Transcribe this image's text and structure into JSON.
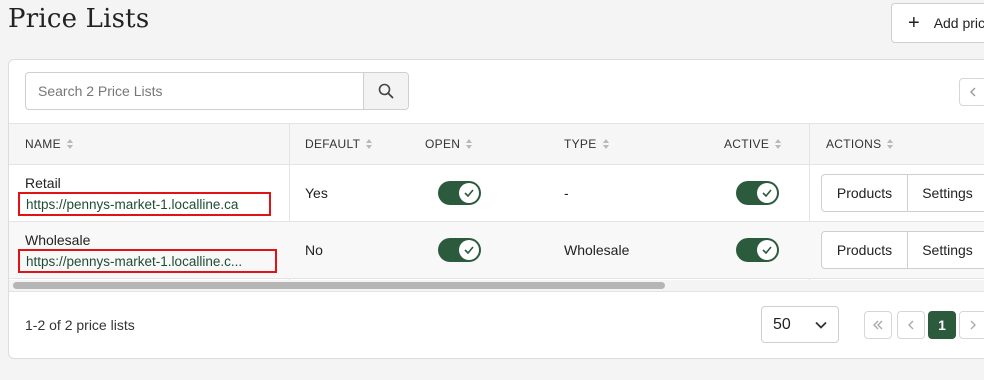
{
  "header": {
    "title": "Price Lists",
    "add_button_label": "Add price list"
  },
  "search": {
    "placeholder": "Search 2 Price Lists",
    "value": ""
  },
  "table": {
    "columns": [
      "NAME",
      "DEFAULT",
      "OPEN",
      "TYPE",
      "ACTIVE",
      "ACTIONS"
    ],
    "rows": [
      {
        "name": "Retail",
        "url": "https://pennys-market-1.localline.ca",
        "default": "Yes",
        "open": true,
        "type": "-",
        "active": true,
        "actions": [
          "Products",
          "Settings"
        ]
      },
      {
        "name": "Wholesale",
        "url": "https://pennys-market-1.localline.c...",
        "default": "No",
        "open": true,
        "type": "Wholesale",
        "active": true,
        "actions": [
          "Products",
          "Settings"
        ]
      }
    ]
  },
  "footer": {
    "summary": "1-2 of 2 price lists",
    "per_page": "50",
    "current_page": "1"
  },
  "colors": {
    "accent_green": "#2c5a3d",
    "highlight_red": "#e01414"
  },
  "icons": {
    "search": "search-icon",
    "add": "plus-icon",
    "toggle_check": "check-icon",
    "pager_first": "double-chevron-left-icon",
    "pager_prev": "chevron-left-icon",
    "pager_next": "chevron-right-icon",
    "dropdown": "chevron-down-icon"
  }
}
